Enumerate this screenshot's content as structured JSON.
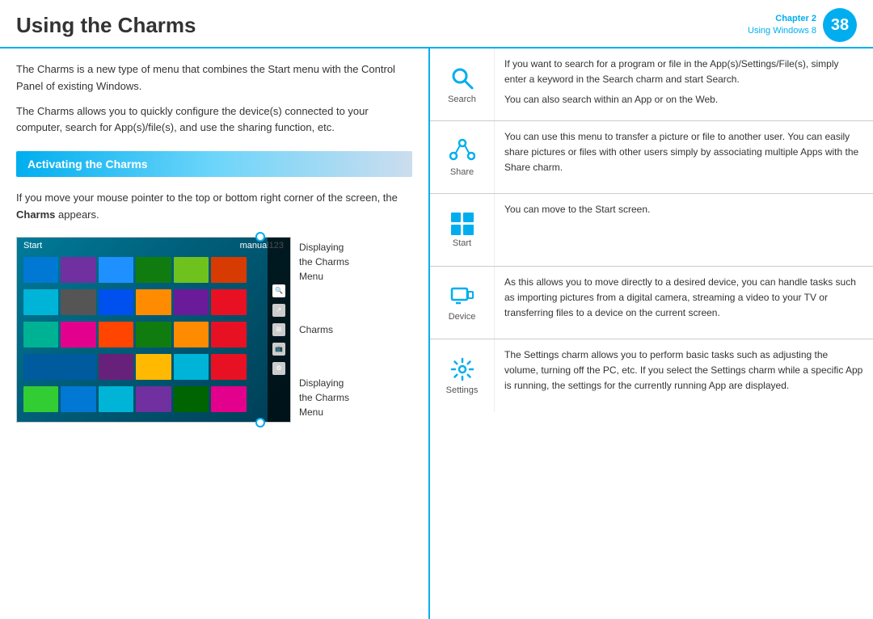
{
  "header": {
    "title": "Using the Charms",
    "chapter_label": "Chapter 2",
    "chapter_sublabel": "Using Windows 8",
    "chapter_number": "38"
  },
  "left": {
    "intro1": "The Charms is a new type of menu that combines the Start menu with the Control Panel of existing Windows.",
    "intro2": "The Charms allows you to quickly configure the device(s) connected to your computer, search for App(s)/file(s), and use the sharing function, etc.",
    "section_header": "Activating the Charms",
    "charms_desc1": "If you move your mouse pointer to the top or bottom right corner of the screen, the ",
    "charms_desc_bold": "Charms",
    "charms_desc2": " appears.",
    "label_top1": "Displaying",
    "label_top2": "the Charms",
    "label_top3": "Menu",
    "label_mid": "Charms",
    "label_bot1": "Displaying",
    "label_bot2": "the Charms",
    "label_bot3": "Menu",
    "win8_start": "Start",
    "win8_user": "manual123"
  },
  "right": {
    "charms": [
      {
        "id": "search",
        "label": "Search",
        "icon": "search",
        "text": "If you want to search for a program or file in the App(s)/Settings/File(s), simply enter a keyword in the Search charm and start Search.\n\nYou can also search within an App or on the Web."
      },
      {
        "id": "share",
        "label": "Share",
        "icon": "share",
        "text": "You can use this menu to transfer a picture or file to another user. You can easily share pictures or files with other users simply by associating multiple Apps with the Share charm."
      },
      {
        "id": "start",
        "label": "Start",
        "icon": "start",
        "text": "You can move to the Start screen."
      },
      {
        "id": "device",
        "label": "Device",
        "icon": "device",
        "text": "As this allows you to move directly to a desired device, you can handle tasks such as importing pictures from a digital camera, streaming a video to your TV or transferring files to a device on the current screen."
      },
      {
        "id": "settings",
        "label": "Settings",
        "icon": "settings",
        "text": "The Settings charm allows you to perform basic tasks such as adjusting the volume, turning off the PC, etc. If you select the Settings charm while a specific App is running, the settings for the currently running App are displayed."
      }
    ]
  }
}
